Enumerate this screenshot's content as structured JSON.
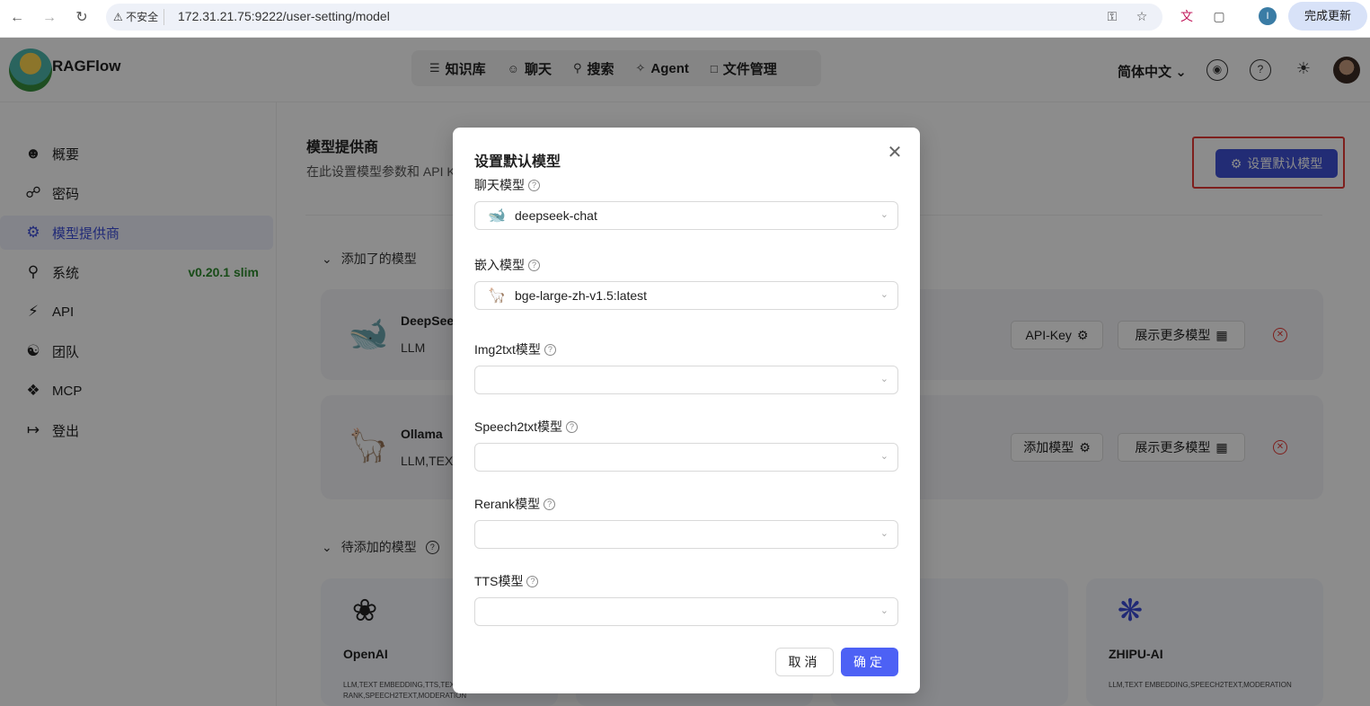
{
  "browser": {
    "insecure_label": "不安全",
    "url": "172.31.21.75:9222/user-setting/model",
    "profile_initial": "I",
    "update_label": "完成更新"
  },
  "header": {
    "brand": "RAGFlow",
    "nav": [
      {
        "label": "知识库",
        "icon": "database-icon"
      },
      {
        "label": "聊天",
        "icon": "chat-icon"
      },
      {
        "label": "搜索",
        "icon": "search-icon"
      },
      {
        "label": "Agent",
        "icon": "agent-icon"
      },
      {
        "label": "文件管理",
        "icon": "folder-icon"
      }
    ],
    "language": "简体中文"
  },
  "sidebar": {
    "items": [
      {
        "label": "概要",
        "icon": "user-icon"
      },
      {
        "label": "密码",
        "icon": "lock-icon"
      },
      {
        "label": "模型提供商",
        "icon": "model-icon"
      },
      {
        "label": "系统",
        "icon": "system-icon"
      },
      {
        "label": "API",
        "icon": "api-icon"
      },
      {
        "label": "团队",
        "icon": "team-icon"
      },
      {
        "label": "MCP",
        "icon": "mcp-icon"
      },
      {
        "label": "登出",
        "icon": "logout-icon"
      }
    ],
    "version": "v0.20.1 slim"
  },
  "main": {
    "title": "模型提供商",
    "subtitle": "在此设置模型参数和 API K",
    "set_default_label": "设置默认模型",
    "added_section": "添加了的模型",
    "pending_section": "待添加的模型",
    "added_cards": [
      {
        "name": "DeepSee",
        "type": "LLM",
        "primary_btn": "API-Key",
        "more_btn": "展示更多模型"
      },
      {
        "name": "Ollama",
        "type": "LLM,TEX",
        "primary_btn": "添加模型",
        "more_btn": "展示更多模型"
      }
    ],
    "pending_cards": [
      {
        "name": "OpenAI",
        "tags": "LLM,TEXT EMBEDDING,TTS,TEXT RE RANK,SPEECH2TEXT,MODERATION"
      },
      {
        "name": "ZHIPU-AI",
        "tags": "LLM,TEXT EMBEDDING,SPEECH2TEXT,MODERATION"
      }
    ]
  },
  "modal": {
    "title": "设置默认模型",
    "fields": [
      {
        "label": "聊天模型",
        "value": "deepseek-chat",
        "icon": "deepseek-icon"
      },
      {
        "label": "嵌入模型",
        "value": "bge-large-zh-v1.5:latest",
        "icon": "ollama-icon"
      },
      {
        "label": "Img2txt模型",
        "value": ""
      },
      {
        "label": "Speech2txt模型",
        "value": ""
      },
      {
        "label": "Rerank模型",
        "value": ""
      },
      {
        "label": "TTS模型",
        "value": ""
      }
    ],
    "cancel_label": "取消",
    "ok_label": "确定"
  }
}
